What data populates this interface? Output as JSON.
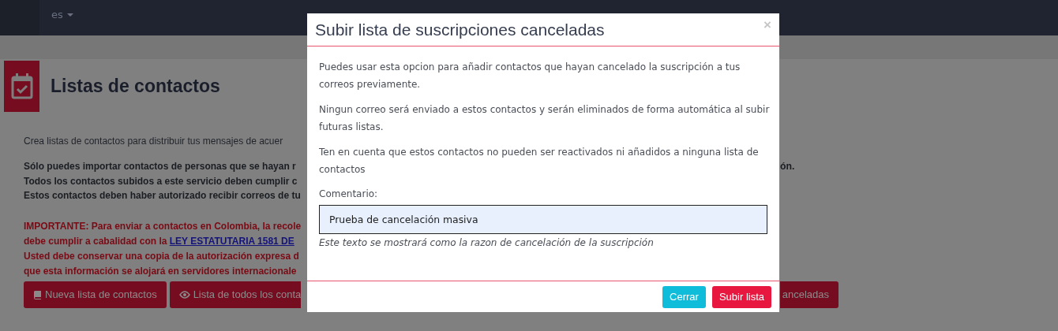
{
  "navbar": {
    "language": "es"
  },
  "page": {
    "title": "Listas de contactos",
    "intro": "Crea listas de contactos para distribuir tus mensajes de acuer",
    "notice_lines": [
      {
        "left": "Sólo puedes importar contactos de personas que se hayan r",
        "right": "ón."
      },
      {
        "left": "Todos los contactos subidos a este servicio deben cumplir c"
      },
      {
        "left": "Estos contactos deben haber autorizado recibir correos de tu"
      }
    ],
    "important_lines": [
      {
        "text": "IMPORTANTE: Para enviar a contactos en Colombia, la recole"
      },
      {
        "text": "debe cumplir a cabalidad con la ",
        "link": "LEY ESTATUTARIA 1581 DE"
      },
      {
        "text": "Usted debe conservar una copia de la autorización expresa d"
      },
      {
        "text": "que esta información se alojará en servidores internacionale"
      }
    ],
    "buttons": [
      {
        "label": "Nueva lista de contactos"
      },
      {
        "label": "Lista de todos los conta"
      }
    ],
    "right_button": {
      "label": "anceladas"
    }
  },
  "modal": {
    "title": "Subir lista de suscripciones canceladas",
    "close": "×",
    "paragraphs": [
      "Puedes usar esta opcion para añadir contactos que hayan cancelado la suscripción a tus correos previamente.",
      "Ningun correo será enviado a estos contactos y serán eliminados de forma automática al subir futuras listas.",
      "Ten en cuenta que estos contactos no pueden ser reactivados ni añadidos a ninguna lista de contactos"
    ],
    "field": {
      "label": "Comentario:",
      "value": "Prueba de cancelación masiva",
      "help": "Este texto se mostrará como la razon de cancelación de la suscripción"
    },
    "buttons": [
      {
        "label": "Cerrar",
        "kind": "secondary"
      },
      {
        "label": "Subir lista",
        "kind": "primary"
      }
    ]
  }
}
